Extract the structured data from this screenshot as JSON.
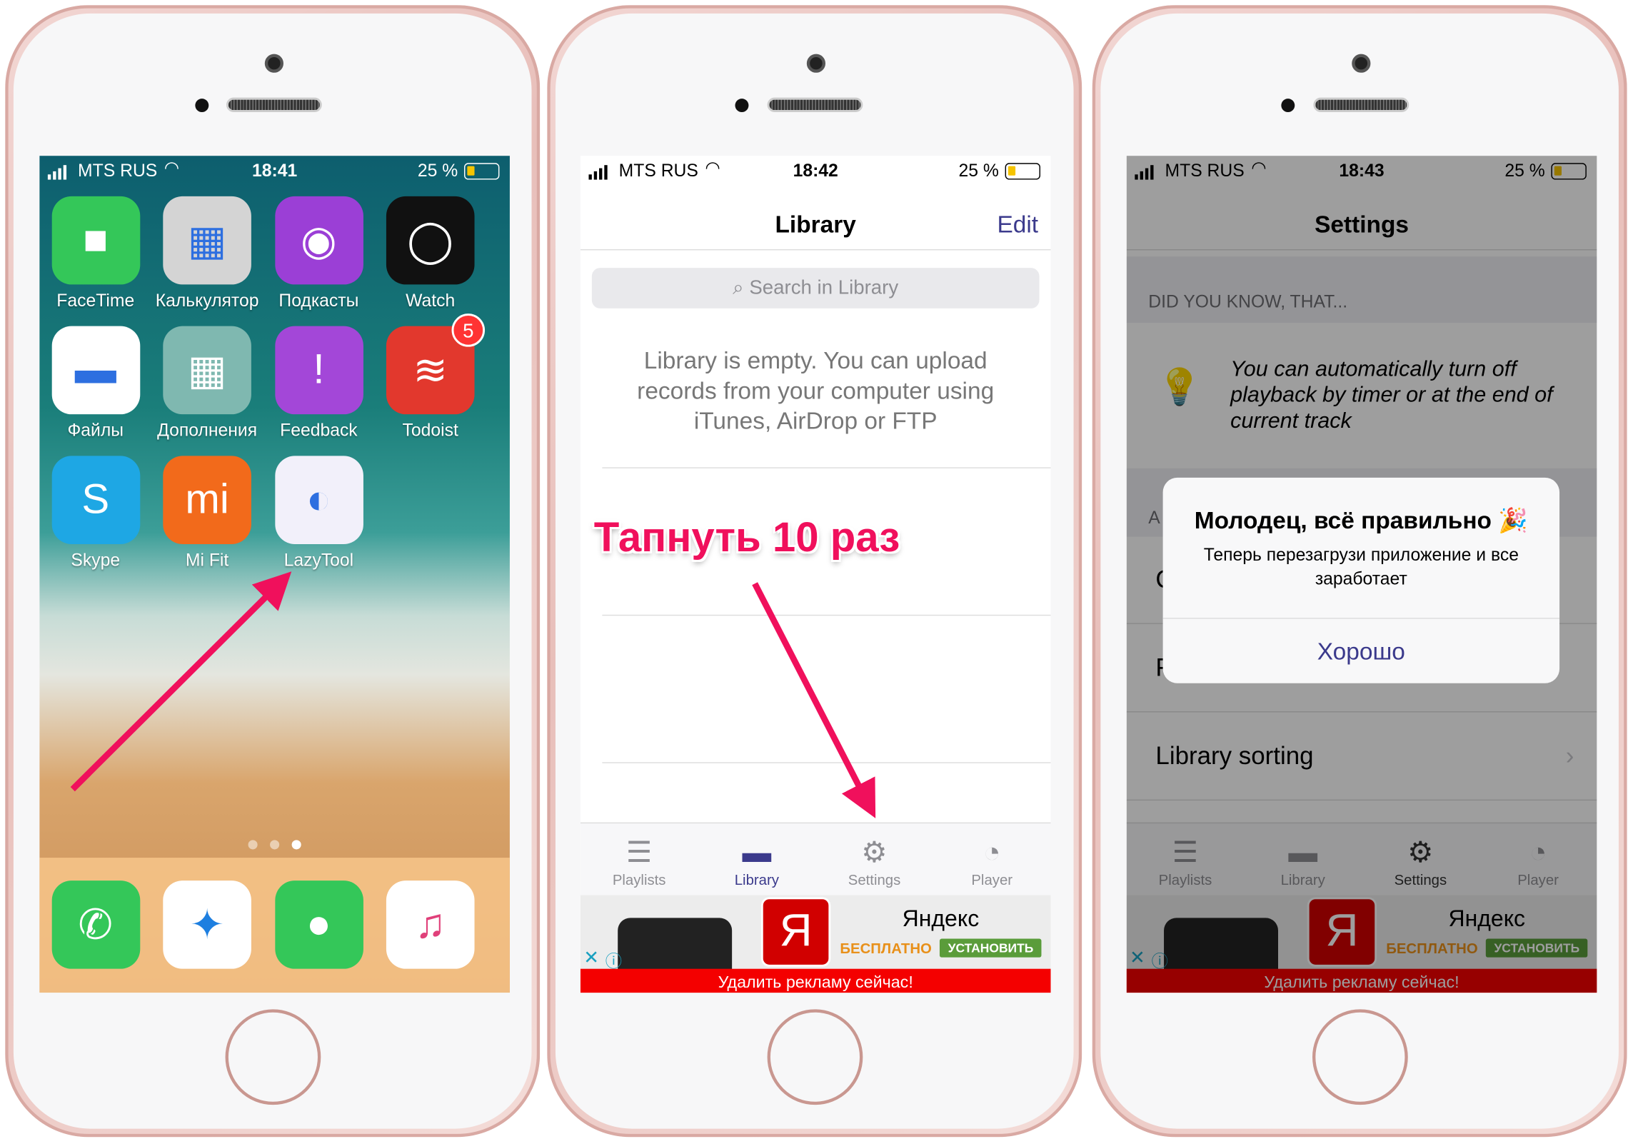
{
  "phone1": {
    "status": {
      "carrier": "MTS RUS",
      "time": "18:41",
      "battery": "25 %"
    },
    "apps": [
      {
        "label": "FaceTime",
        "icon": "facetime-icon",
        "color": "#34c759"
      },
      {
        "label": "Калькулятор",
        "icon": "calculator-icon",
        "color": "#d4d4d4"
      },
      {
        "label": "Подкасты",
        "icon": "podcasts-icon",
        "color": "#9b3fd6"
      },
      {
        "label": "Watch",
        "icon": "watch-icon",
        "color": "#111111"
      },
      {
        "label": "Файлы",
        "icon": "files-icon",
        "color": "#ffffff"
      },
      {
        "label": "Дополнения",
        "icon": "folder-icon",
        "color": "#7fb8b0"
      },
      {
        "label": "Feedback",
        "icon": "feedback-icon",
        "color": "#a347d8"
      },
      {
        "label": "Todoist",
        "icon": "todoist-icon",
        "color": "#e2382d",
        "badge": "5"
      },
      {
        "label": "Skype",
        "icon": "skype-icon",
        "color": "#1ea7e4"
      },
      {
        "label": "Mi Fit",
        "icon": "mifit-icon",
        "color": "#f26a1b"
      },
      {
        "label": "LazyTool",
        "icon": "lazytool-icon",
        "color": "#f2f0fa"
      }
    ],
    "dock": [
      {
        "icon": "phone-icon",
        "color": "#34c759"
      },
      {
        "icon": "safari-icon",
        "color": "#ffffff"
      },
      {
        "icon": "messages-icon",
        "color": "#34c759"
      },
      {
        "icon": "music-icon",
        "color": "#ffffff"
      }
    ]
  },
  "phone2": {
    "status": {
      "carrier": "MTS RUS",
      "time": "18:42",
      "battery": "25 %"
    },
    "title": "Library",
    "edit": "Edit",
    "search_placeholder": "Search in Library",
    "empty_text": "Library is empty. You can upload records from your computer using iTunes, AirDrop or FTP",
    "annotation": "Тапнуть 10 раз",
    "tabs": [
      "Playlists",
      "Library",
      "Settings",
      "Player"
    ],
    "active_tab": "Library"
  },
  "phone3": {
    "status": {
      "carrier": "MTS RUS",
      "time": "18:43",
      "battery": "25 %"
    },
    "title": "Settings",
    "section_tip": "DID YOU KNOW, THAT...",
    "tip_text": "You can automatically turn off playback by timer or at the end of current track",
    "section2_fragment": "A",
    "row1_fragment": "C",
    "row2_fragment": "F",
    "row3": "Library sorting",
    "alert": {
      "title": "Молодец, всё правильно 🎉",
      "message": "Теперь перезагрузи приложение и все заработает",
      "button": "Хорошо"
    },
    "tabs": [
      "Playlists",
      "Library",
      "Settings",
      "Player"
    ],
    "active_tab": "Settings"
  },
  "ad": {
    "brand": "Яндекс",
    "logo": "Я",
    "free": "БЕСПЛАТНО",
    "install": "УСТАНОВИТЬ",
    "remove": "Удалить рекламу сейчас!"
  },
  "colors": {
    "accent": "#3b3a8c",
    "annotation": "#f0105c",
    "ad_red": "#f40000"
  }
}
